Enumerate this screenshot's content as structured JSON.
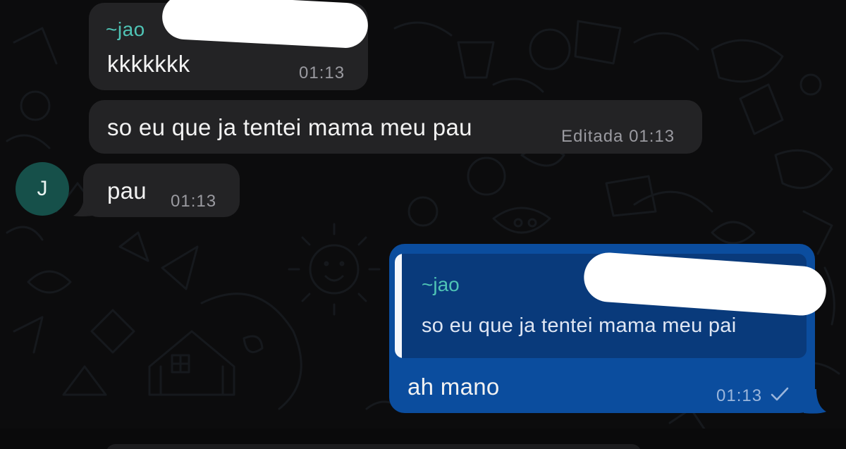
{
  "colors": {
    "background": "#0c0c0d",
    "incoming_bubble": "#232325",
    "outgoing_bubble": "#0b4d9e",
    "quote_background": "#093a7b",
    "sender_name": "#4fc3b5",
    "avatar": "#16504a"
  },
  "messages": [
    {
      "direction": "incoming",
      "sender": "~jao",
      "text": "kkkkkkk",
      "time": "01:13"
    },
    {
      "direction": "incoming",
      "text": "so eu que ja tentei mama meu pau",
      "time": "Editada 01:13"
    },
    {
      "direction": "incoming",
      "avatar_letter": "J",
      "text": "pau",
      "time": "01:13"
    },
    {
      "direction": "outgoing",
      "quote": {
        "sender": "~jao",
        "text": "so eu que ja tentei mama meu pai"
      },
      "text": "ah mano",
      "time": "01:13",
      "status_icon": "single-check-icon"
    }
  ]
}
